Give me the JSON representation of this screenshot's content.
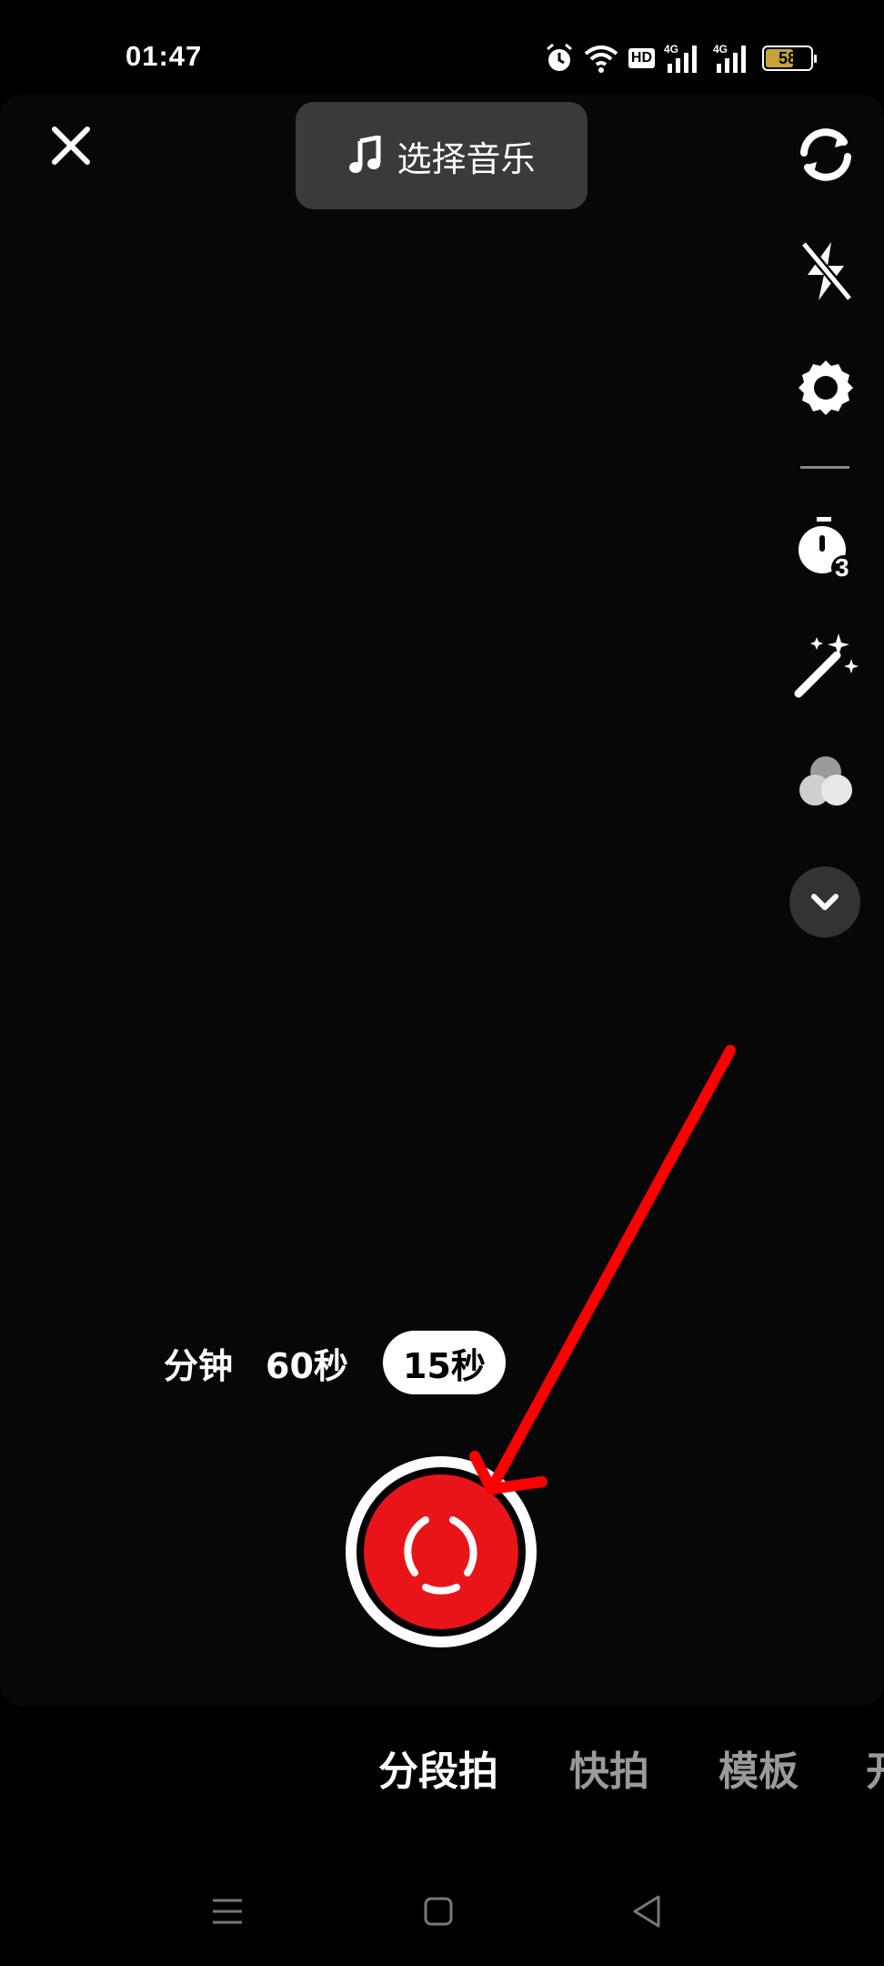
{
  "status_bar": {
    "time": "01:47",
    "icons": [
      "alarm-icon",
      "wifi-icon",
      "hd-badge",
      "signal-4g-icon",
      "signal-4g-icon",
      "battery-icon"
    ],
    "hd_label": "HD",
    "net1": "4G",
    "net2": "4G",
    "battery_level": "58",
    "battery_color": "#c7a33a"
  },
  "top_bar": {
    "music_label": "选择音乐"
  },
  "side_tools": [
    "flip-camera-icon",
    "flash-off-icon",
    "settings-icon",
    "timer-icon",
    "magic-wand-icon",
    "filter-icon",
    "chevron-down-icon"
  ],
  "timer_badge": "3",
  "durations": {
    "faded": "分钟",
    "d60": "60秒",
    "d15": "15秒",
    "selected": "15秒"
  },
  "modes": {
    "active": "分段拍",
    "m2": "快拍",
    "m3": "模板",
    "m4": "开"
  },
  "colors": {
    "shutter": "#e8141a",
    "annotation_arrow": "#ff0000",
    "music_button_bg": "#3a3a3a"
  }
}
